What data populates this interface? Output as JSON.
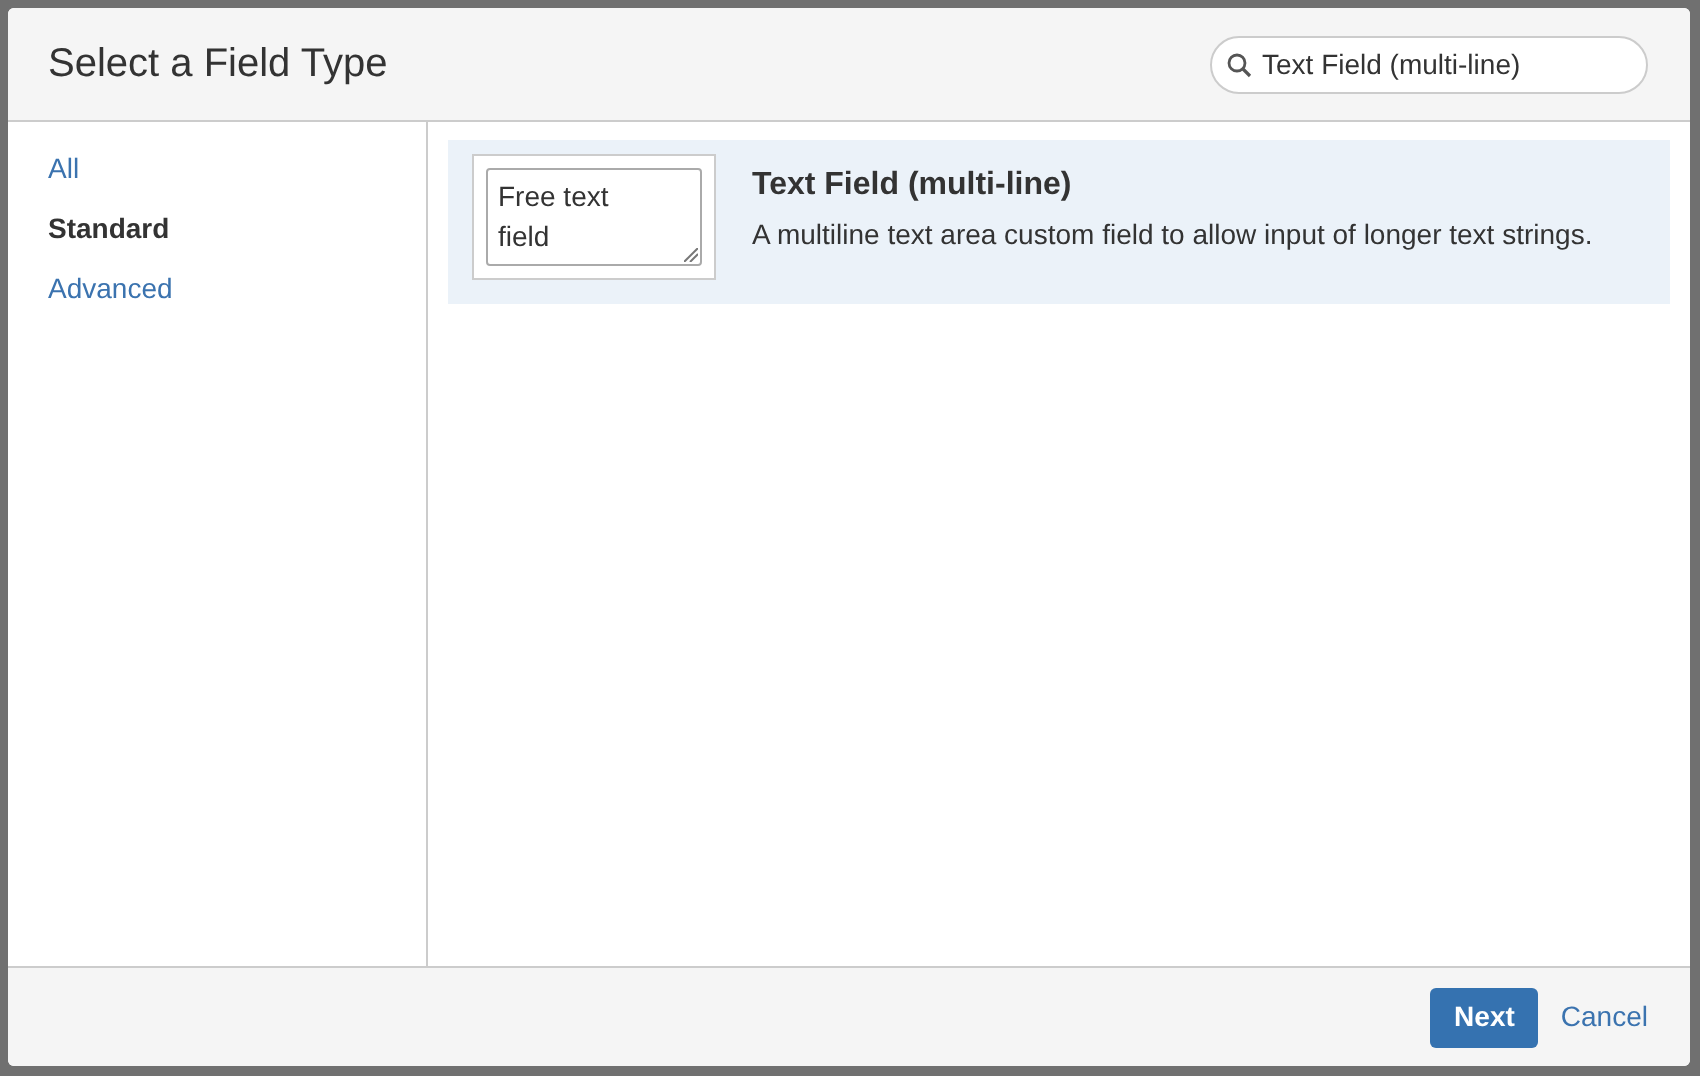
{
  "dialog": {
    "title": "Select a Field Type"
  },
  "search": {
    "value": "Text Field (multi-line)"
  },
  "sidebar": {
    "items": [
      {
        "label": "All",
        "selected": false
      },
      {
        "label": "Standard",
        "selected": true
      },
      {
        "label": "Advanced",
        "selected": false
      }
    ]
  },
  "field_types": [
    {
      "name": "Text Field (multi-line)",
      "description": "A multiline text area custom field to allow input of longer text strings.",
      "preview_text": "Free text field",
      "selected": true
    }
  ],
  "buttons": {
    "next": "Next",
    "cancel": "Cancel"
  }
}
